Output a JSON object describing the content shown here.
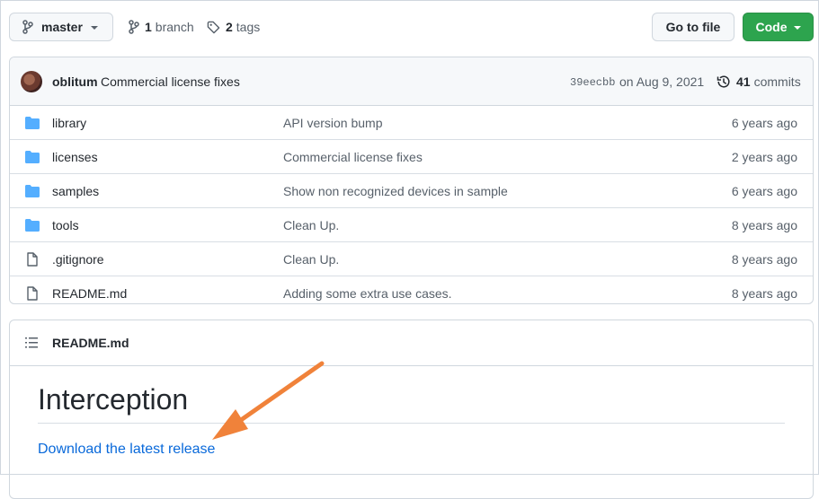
{
  "branch": {
    "name": "master"
  },
  "repo_meta": {
    "branch_count": "1",
    "branch_label": "branch",
    "tag_count": "2",
    "tag_label": "tags"
  },
  "toolbar": {
    "goto_label": "Go to file",
    "code_label": "Code"
  },
  "commit": {
    "author": "oblitum",
    "message": "Commercial license fixes",
    "sha": "39eecbb",
    "date": "on Aug 9, 2021",
    "count": "41",
    "count_label": "commits"
  },
  "files": [
    {
      "type": "dir",
      "name": "library",
      "message": "API version bump",
      "age": "6 years ago"
    },
    {
      "type": "dir",
      "name": "licenses",
      "message": "Commercial license fixes",
      "age": "2 years ago"
    },
    {
      "type": "dir",
      "name": "samples",
      "message": "Show non recognized devices in sample",
      "age": "6 years ago"
    },
    {
      "type": "dir",
      "name": "tools",
      "message": "Clean Up.",
      "age": "8 years ago"
    },
    {
      "type": "file",
      "name": ".gitignore",
      "message": "Clean Up.",
      "age": "8 years ago"
    },
    {
      "type": "file",
      "name": "README.md",
      "message": "Adding some extra use cases.",
      "age": "8 years ago"
    }
  ],
  "readme": {
    "title": "README.md",
    "heading": "Interception",
    "link_text": "Download the latest release"
  },
  "colors": {
    "accent": "#0969da",
    "code_button": "#2da44e",
    "folder": "#54aeff",
    "annotation_arrow": "#f0823a"
  }
}
